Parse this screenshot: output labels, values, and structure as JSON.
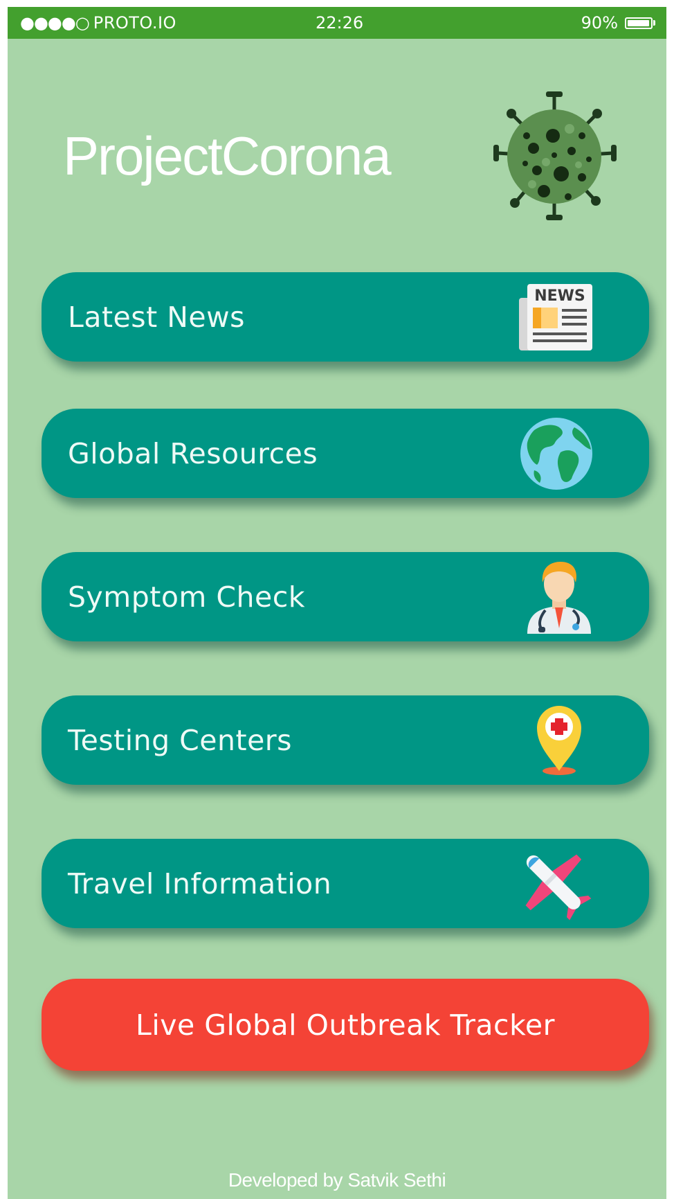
{
  "status_bar": {
    "signal": "●●●●○",
    "carrier": "PROTO.IO",
    "time": "22:26",
    "battery": "90%"
  },
  "app": {
    "title": "ProjectCorona",
    "logo_icon": "virus-icon"
  },
  "menu": [
    {
      "label": "Latest News",
      "icon": "newspaper-icon"
    },
    {
      "label": "Global Resources",
      "icon": "globe-icon"
    },
    {
      "label": "Symptom Check",
      "icon": "doctor-icon"
    },
    {
      "label": "Testing Centers",
      "icon": "map-pin-medical-icon"
    },
    {
      "label": "Travel Information",
      "icon": "airplane-icon"
    }
  ],
  "tracker_button": {
    "label": "Live Global Outbreak Tracker"
  },
  "footer": {
    "text": "Developed by Satvik Sethi"
  },
  "colors": {
    "background": "#a8d5a8",
    "status_bar": "#43a02e",
    "menu_button": "#009685",
    "tracker_button": "#f44336"
  }
}
